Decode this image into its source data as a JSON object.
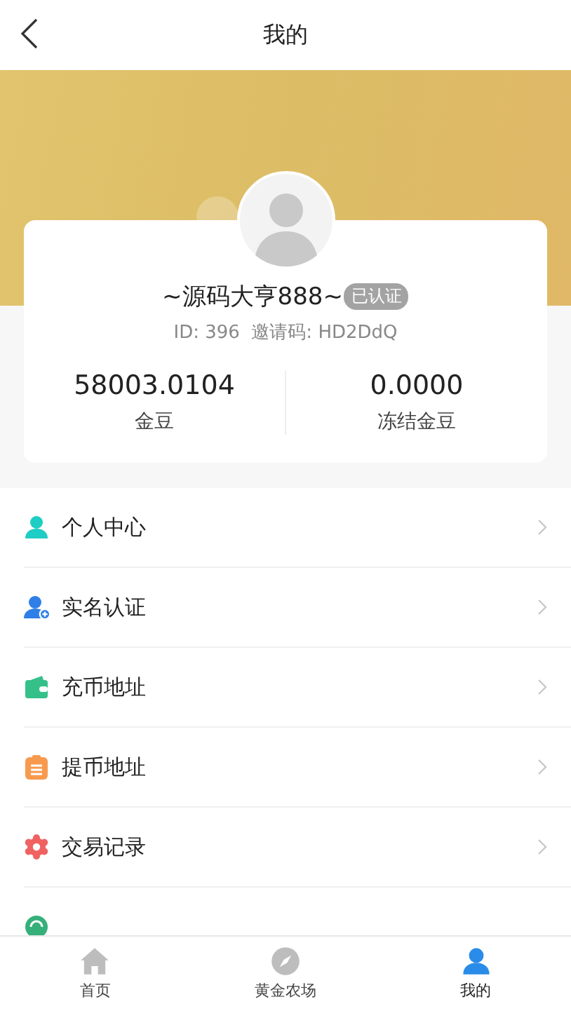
{
  "header": {
    "title": "我的"
  },
  "profile": {
    "name": "~源码大亨888~",
    "verified": true,
    "badge": "已认证",
    "id_line": "ID: 396  邀请码: HD2DdQ",
    "stats": [
      {
        "value": "58003.0104",
        "label": "金豆"
      },
      {
        "value": "0.0000",
        "label": "冻结金豆"
      }
    ]
  },
  "menu": [
    {
      "label": "个人中心",
      "kind": "profile"
    },
    {
      "label": "实名认证",
      "kind": "verify"
    },
    {
      "label": "充币地址",
      "kind": "deposit"
    },
    {
      "label": "提币地址",
      "kind": "withdraw"
    },
    {
      "label": "交易记录",
      "kind": "records"
    },
    {
      "kind": "partial"
    }
  ],
  "tabs": [
    {
      "label": "首页",
      "kind": "home",
      "selected": false
    },
    {
      "label": "黄金农场",
      "kind": "farm",
      "selected": false
    },
    {
      "label": "我的",
      "kind": "mine",
      "selected": true
    }
  ]
}
